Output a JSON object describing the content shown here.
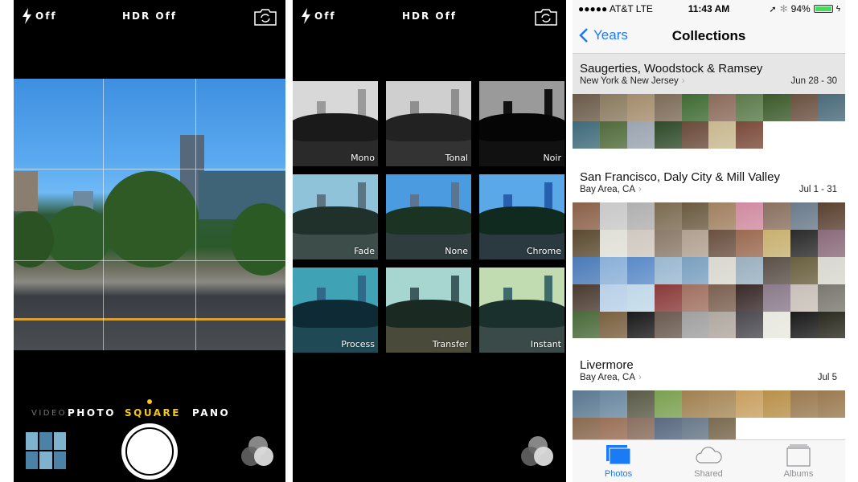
{
  "camera_screen": {
    "flash_label": "Off",
    "hdr_label": "HDR Off",
    "modes": [
      "VIDEO",
      "PHOTO",
      "SQUARE",
      "PANO"
    ],
    "active_mode": "SQUARE",
    "accent_color": "#f5c518"
  },
  "filter_screen": {
    "flash_label": "Off",
    "hdr_label": "HDR Off",
    "filters": [
      "Mono",
      "Tonal",
      "Noir",
      "Fade",
      "None",
      "Chrome",
      "Process",
      "Transfer",
      "Instant"
    ]
  },
  "photos_app": {
    "status_bar": {
      "carrier": "●●●●● AT&T  LTE",
      "time": "11:43 AM",
      "battery": "94%"
    },
    "nav": {
      "back_label": "Years",
      "title": "Collections"
    },
    "collections": [
      {
        "title": "Saugerties, Woodstock & Ramsey",
        "subtitle": "New York & New Jersey",
        "date": "Jun 28 - 30"
      },
      {
        "title": "San Francisco, Daly City & Mill Valley",
        "subtitle": "Bay Area, CA",
        "date": "Jul 1 - 31"
      },
      {
        "title": "Livermore",
        "subtitle": "Bay Area, CA",
        "date": "Jul 5"
      }
    ],
    "tabs": [
      {
        "label": "Photos",
        "active": true
      },
      {
        "label": "Shared",
        "active": false
      },
      {
        "label": "Albums",
        "active": false
      }
    ],
    "accent_color": "#1b7bf5"
  }
}
